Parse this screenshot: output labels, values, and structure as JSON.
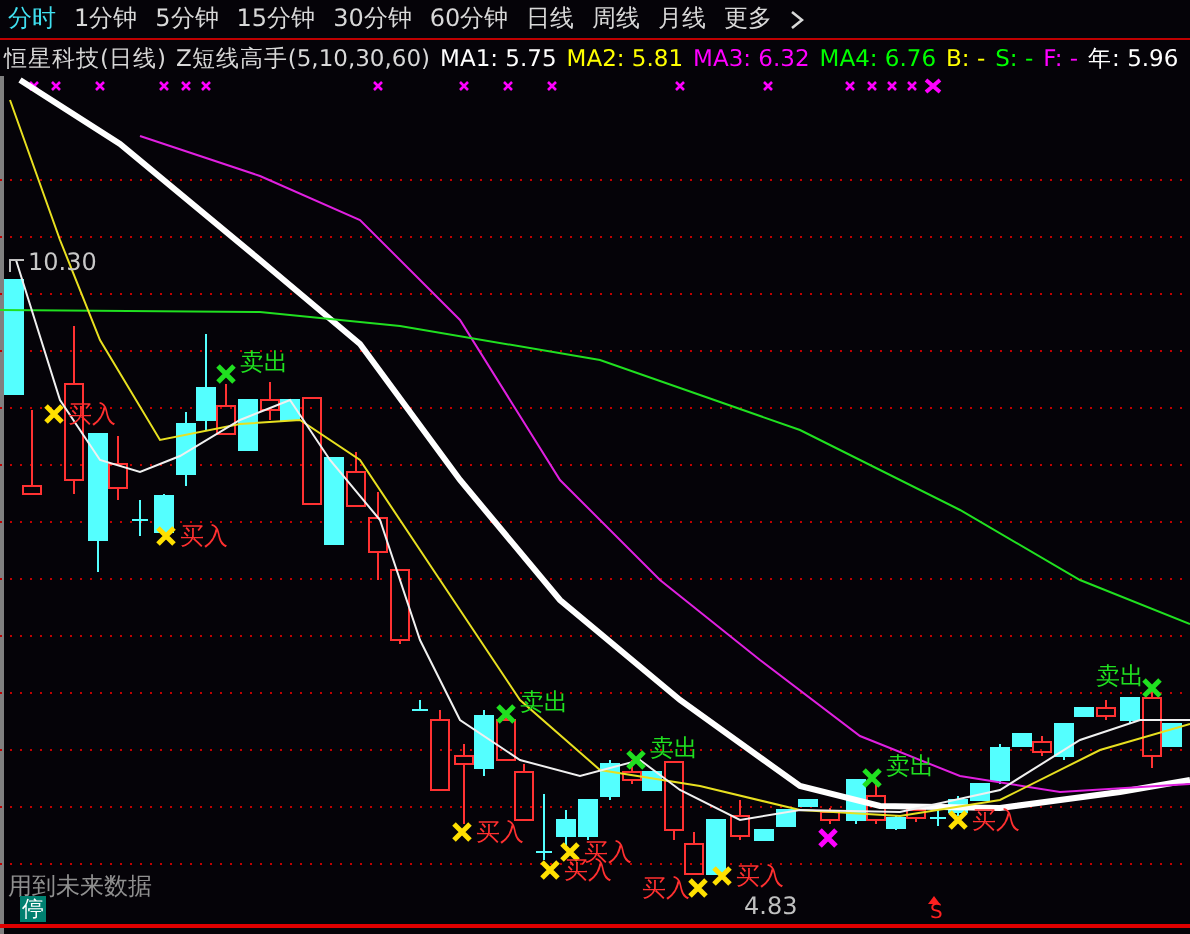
{
  "tabs": [
    {
      "label": "分时",
      "selected": true
    },
    {
      "label": "1分钟",
      "selected": false
    },
    {
      "label": "5分钟",
      "selected": false
    },
    {
      "label": "15分钟",
      "selected": false
    },
    {
      "label": "30分钟",
      "selected": false
    },
    {
      "label": "60分钟",
      "selected": false
    },
    {
      "label": "日线",
      "selected": false
    },
    {
      "label": "周线",
      "selected": false
    },
    {
      "label": "月线",
      "selected": false
    },
    {
      "label": "更多",
      "selected": false
    }
  ],
  "legend": {
    "title": "恒星科技(日线)",
    "indicator": "Z短线高手(5,10,30,60)",
    "items": [
      {
        "label": "MA1:",
        "value": "5.75",
        "color": "#ffffff"
      },
      {
        "label": "MA2:",
        "value": "5.81",
        "color": "#ffff00"
      },
      {
        "label": "MA3:",
        "value": "6.32",
        "color": "#ff00ff"
      },
      {
        "label": "MA4:",
        "value": "6.76",
        "color": "#00ff00"
      },
      {
        "label": "B:",
        "value": "-",
        "color": "#ffff00"
      },
      {
        "label": "S:",
        "value": "-",
        "color": "#00ff00"
      },
      {
        "label": "F:",
        "value": "-",
        "color": "#ff00ff"
      },
      {
        "label": "年:",
        "value": "5.96",
        "color": "#ffffff"
      }
    ]
  },
  "chart": {
    "high_label": "10.30",
    "low_label": "4.83",
    "signals": [
      {
        "kind": "buy",
        "text": "买入"
      },
      {
        "kind": "buy",
        "text": "买入"
      },
      {
        "kind": "sell",
        "text": "卖出"
      },
      {
        "kind": "buy",
        "text": "买入"
      },
      {
        "kind": "sell",
        "text": "卖出"
      },
      {
        "kind": "buy",
        "text": "买入"
      },
      {
        "kind": "buy",
        "text": "买入"
      },
      {
        "kind": "sell",
        "text": "卖出"
      },
      {
        "kind": "buy",
        "text": "买入"
      },
      {
        "kind": "buy",
        "text": "买入"
      },
      {
        "kind": "sell",
        "text": "卖出"
      },
      {
        "kind": "buy",
        "text": "买入"
      },
      {
        "kind": "sell",
        "text": "卖出"
      }
    ],
    "footnote": "用到未来数据",
    "status_badge": "停",
    "marker": "S"
  }
}
